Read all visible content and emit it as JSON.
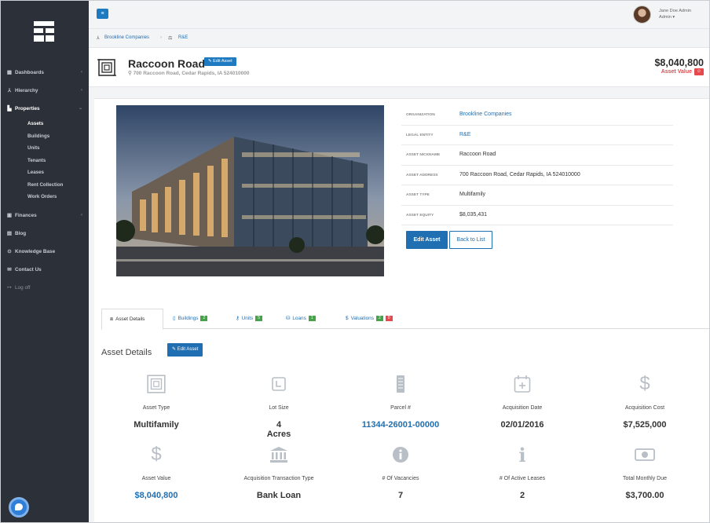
{
  "sidebar": {
    "items": [
      {
        "label": "Dashboards",
        "icon": "grid-icon"
      },
      {
        "label": "Hierarchy",
        "icon": "hierarchy-icon"
      },
      {
        "label": "Properties",
        "icon": "chart-icon"
      },
      {
        "label": "Finances",
        "icon": "finance-icon"
      },
      {
        "label": "Blog",
        "icon": "blog-icon"
      },
      {
        "label": "Knowledge Base",
        "icon": "help-icon"
      },
      {
        "label": "Contact Us",
        "icon": "mail-icon"
      },
      {
        "label": "Log off",
        "icon": "logout-icon"
      }
    ],
    "sub_items": [
      "Assets",
      "Buildings",
      "Units",
      "Tenants",
      "Leases",
      "Rent Collection",
      "Work Orders"
    ]
  },
  "user": {
    "name": "Jane Doe Admin",
    "role": "Admin ▾"
  },
  "breadcrumb": {
    "org": "Brookline Companies",
    "sep": "›",
    "entity": "R&E"
  },
  "header": {
    "title": "Raccoon Road",
    "edit_label": "Edit Asset",
    "address": "700 Raccoon Road, Cedar Rapids, IA 524010000",
    "value": "$8,040,800",
    "value_label": "Asset Value"
  },
  "info": {
    "rows": [
      {
        "key": "Organization",
        "value": "Brookline Companies"
      },
      {
        "key": "Legal Entity",
        "value": "R&E"
      },
      {
        "key": "Asset Nickname",
        "value": "Raccoon Road"
      },
      {
        "key": "Asset Address",
        "value": "700 Raccoon Road, Cedar Rapids, IA 524010000"
      },
      {
        "key": "Asset Type",
        "value": "Multifamily"
      },
      {
        "key": "Asset Equity",
        "value": "$8,035,431"
      }
    ],
    "edit_button": "Edit Asset",
    "back_button": "Back to List"
  },
  "tabs": [
    {
      "label": "Asset Details"
    },
    {
      "label": "Buildings",
      "badge": "2"
    },
    {
      "label": "Units",
      "badge": "5"
    },
    {
      "label": "Loans",
      "badge": "1"
    },
    {
      "label": "Valuations",
      "badge": "2",
      "badge2": "0"
    }
  ],
  "details": {
    "title": "Asset Details",
    "edit_label": "Edit Asset",
    "stats": [
      {
        "label": "Asset Type",
        "value": "Multifamily",
        "icon": "building-outline-icon"
      },
      {
        "label": "Lot Size",
        "value": "4",
        "value2": "Acres",
        "icon": "lot-icon"
      },
      {
        "label": "Parcel #",
        "value": "11344-26001-00000",
        "icon": "parcel-icon"
      },
      {
        "label": "Acquisition Date",
        "value": "02/01/2016",
        "icon": "calendar-icon"
      },
      {
        "label": "Acquisition Cost",
        "value": "$7,525,000",
        "icon": "dollar-icon"
      },
      {
        "label": "Asset Value",
        "value": "$8,040,800",
        "icon": "dollar-icon"
      },
      {
        "label": "Acquisition Transaction Type",
        "value": "Bank Loan",
        "icon": "bank-icon"
      },
      {
        "label": "# Of Vacancies",
        "value": "7",
        "icon": "info-circle-icon"
      },
      {
        "label": "# Of Active Leases",
        "value": "2",
        "icon": "info-icon"
      },
      {
        "label": "Total Monthly Due",
        "value": "$3,700.00",
        "icon": "money-icon"
      }
    ]
  },
  "colors": {
    "sidebar": "#2c3038",
    "accent": "#1f6fb2",
    "danger": "#e5484d",
    "success": "#46a34a"
  }
}
